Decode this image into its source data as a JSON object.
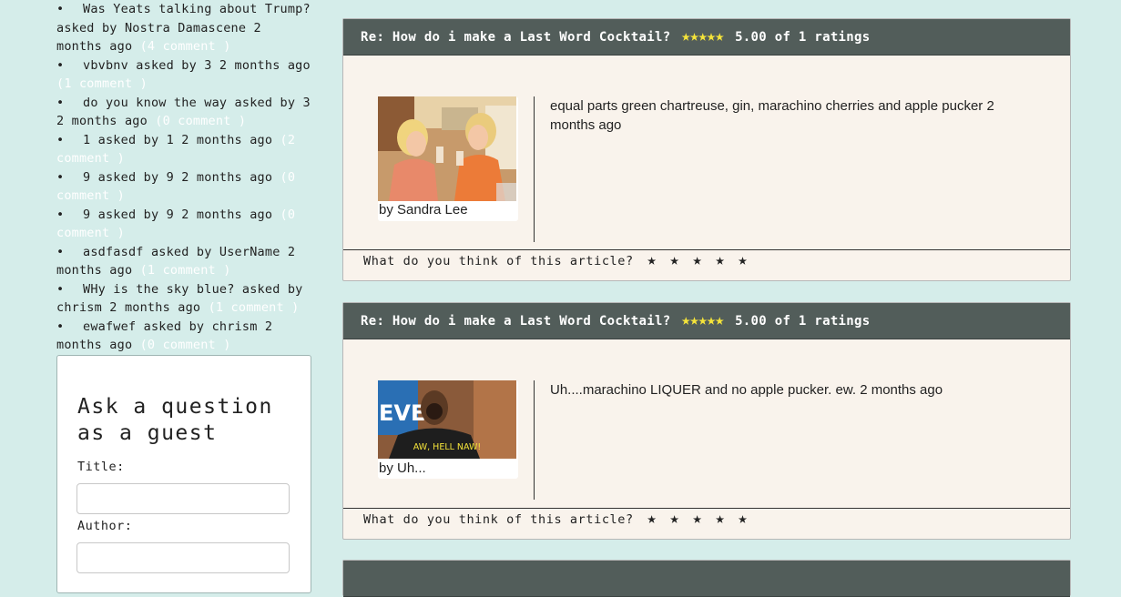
{
  "sidebar": {
    "questions": [
      {
        "text": "Was Yeats talking about Trump? asked by Nostra Damascene 2 months ago",
        "count": "(4 comment )"
      },
      {
        "text": "vbvbnv asked by 3 2 months ago",
        "count": "(1 comment )"
      },
      {
        "text": "do you know the way asked by 3 2 months ago",
        "count": "(0 comment )"
      },
      {
        "text": "1 asked by 1 2 months ago",
        "count": "(2 comment )"
      },
      {
        "text": "9 asked by 9 2 months ago",
        "count": "(0 comment )"
      },
      {
        "text": "9 asked by 9 2 months ago",
        "count": "(0 comment )"
      },
      {
        "text": "asdfasdf asked by UserName 2 months ago",
        "count": "(1 comment )"
      },
      {
        "text": "WHy is the sky blue? asked by chrism 2 months ago",
        "count": "(1 comment )"
      },
      {
        "text": "ewafwef asked by chrism 2 months ago",
        "count": "(0 comment )"
      }
    ],
    "guest_form": {
      "heading": "Ask a question as a guest",
      "title_label": "Title:",
      "title_value": "",
      "author_label": "Author:",
      "author_value": ""
    }
  },
  "answers": [
    {
      "header_title": "Re: How do i make a Last Word Cocktail?",
      "header_stars": "★★★★★",
      "header_rating": "5.00 of 1 ratings",
      "author": "by Sandra Lee",
      "text": "equal parts green chartreuse, gin, marachino cherries and apple pucker 2 months ago",
      "footer_prompt": "What do you think of this article?"
    },
    {
      "header_title": "Re: How do i make a Last Word Cocktail?",
      "header_stars": "★★★★★",
      "header_rating": "5.00 of 1 ratings",
      "author": "by Uh...",
      "text": "Uh....marachino LIQUER and no apple pucker. ew. 2 months ago",
      "footer_prompt": "What do you think of this article?",
      "image_caption": "AW, HELL NAW!",
      "image_sign": "EVE"
    }
  ],
  "rating_star_glyph": "★",
  "colors": {
    "page_bg": "#d5edea",
    "header_bg": "#525d5a",
    "card_bg": "#f9f3ec",
    "star_yellow": "#f5e43a",
    "comment_link": "#ffffff"
  }
}
